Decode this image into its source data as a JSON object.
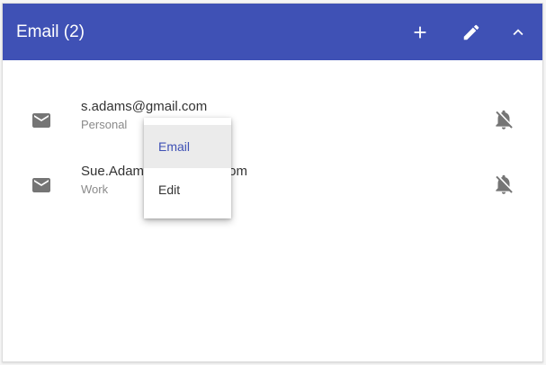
{
  "header": {
    "title": "Email (2)",
    "buttons": [
      {
        "name": "add-button",
        "icon": "plus-icon"
      },
      {
        "name": "edit-button",
        "icon": "pencil-icon"
      },
      {
        "name": "collapse-button",
        "icon": "chevron-up-icon"
      }
    ]
  },
  "emails": [
    {
      "address": "s.adams@gmail.com",
      "type": "Personal",
      "icon": "mail-icon",
      "action_icon": "notifications-off-icon"
    },
    {
      "address": "Sue.Adams@company.com",
      "type": "Work",
      "icon": "mail-icon",
      "action_icon": "notifications-off-icon"
    }
  ],
  "menu": {
    "items": [
      {
        "label": "Email",
        "active": true
      },
      {
        "label": "Edit",
        "active": false
      }
    ]
  },
  "colors": {
    "header_bg": "#3f51b5",
    "menu_active_text": "#3f51b5",
    "icon_gray": "#757575"
  }
}
